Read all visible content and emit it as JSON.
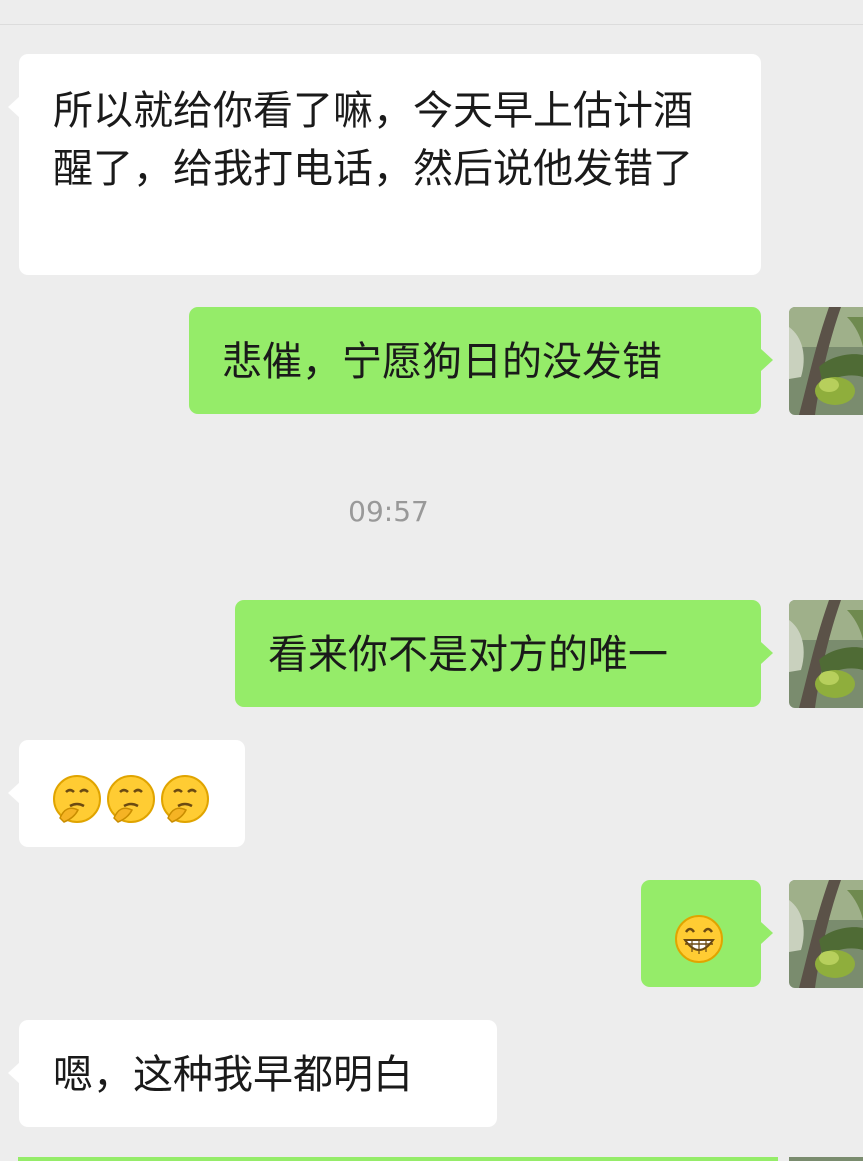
{
  "conversation": {
    "messages": [
      {
        "direction": "in",
        "text": "所以就给你看了嘛，今天早上估计酒醒了，给我打电话，然后说他发错了"
      },
      {
        "direction": "out",
        "text": "悲催，宁愿狗日的没发错"
      },
      {
        "direction": "out",
        "text": "看来你不是对方的唯一"
      },
      {
        "direction": "in",
        "emojis": [
          "thinking-face-icon",
          "thinking-face-icon",
          "thinking-face-icon"
        ]
      },
      {
        "direction": "out",
        "emojis": [
          "grinning-face-icon"
        ]
      },
      {
        "direction": "in",
        "text": "嗯，这种我早都明白"
      }
    ],
    "timestamp": "09:57"
  },
  "colors": {
    "background": "#ededed",
    "incoming_bubble": "#ffffff",
    "outgoing_bubble": "#95ec69",
    "timestamp_text": "#999999"
  },
  "avatar": {
    "icon": "plant-photo-avatar"
  }
}
